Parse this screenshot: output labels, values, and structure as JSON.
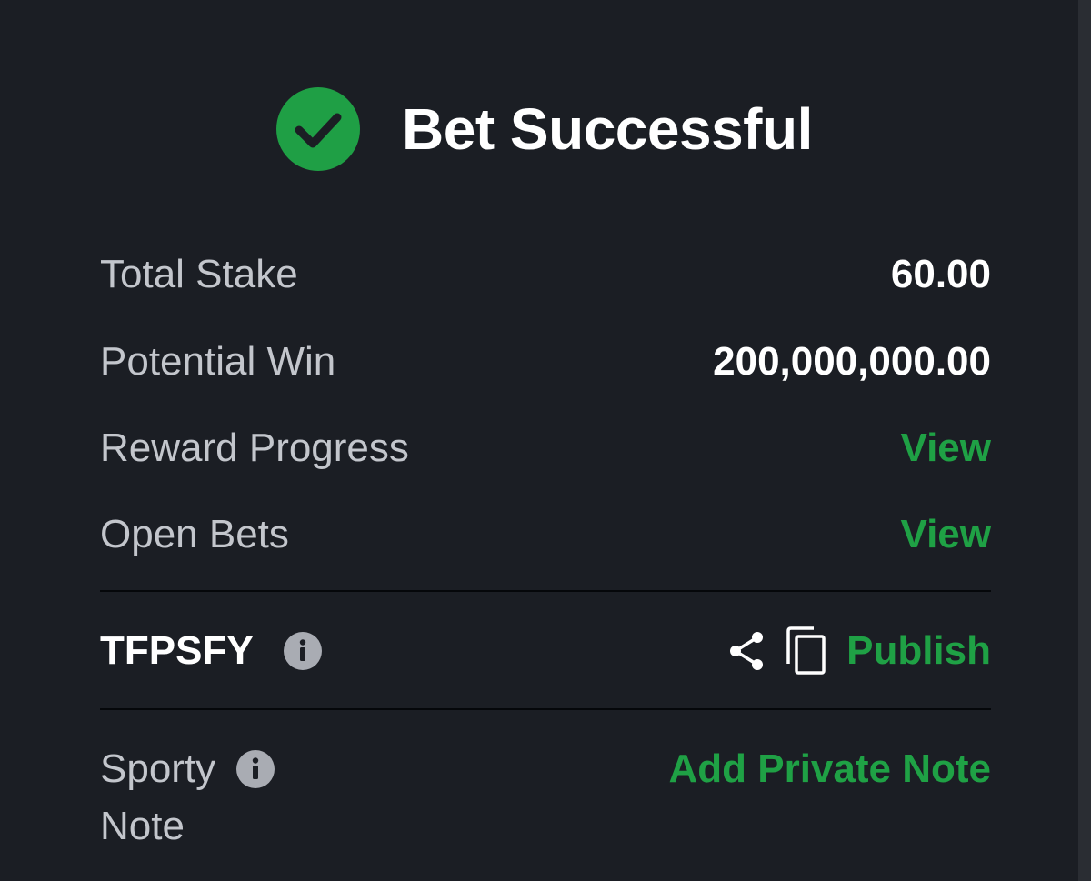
{
  "header": {
    "title": "Bet Successful",
    "icon": "check-circle-icon"
  },
  "summary": {
    "total_stake_label": "Total Stake",
    "total_stake_value": "60.00",
    "potential_win_label": "Potential Win",
    "potential_win_value": "200,000,000.00",
    "reward_progress_label": "Reward Progress",
    "reward_progress_link": "View",
    "open_bets_label": "Open Bets",
    "open_bets_link": "View"
  },
  "booking": {
    "code": "TFPSFY",
    "info_icon": "info-icon",
    "share_icon": "share-icon",
    "copy_icon": "copy-icon",
    "publish_label": "Publish"
  },
  "note": {
    "label_line1": "Sporty",
    "label_line2": "Note",
    "info_icon": "info-icon",
    "add_label": "Add Private Note"
  },
  "colors": {
    "background": "#1b1e24",
    "accent_green": "#1fa145",
    "success_green": "#1f9f45",
    "label_gray": "#c3c6cc",
    "text_white": "#ffffff"
  }
}
